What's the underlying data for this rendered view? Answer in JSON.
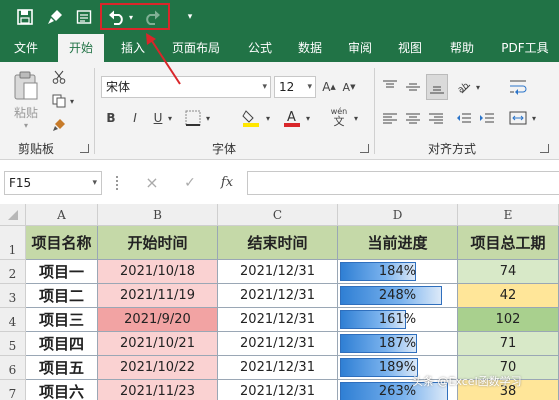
{
  "qat": {
    "save": "save-icon",
    "format_painter": "paintbrush-icon",
    "form": "form-icon",
    "undo": "undo-icon",
    "redo": "redo-icon",
    "customize": "customize-qat-icon"
  },
  "tabs": [
    "文件",
    "开始",
    "插入",
    "页面布局",
    "公式",
    "数据",
    "审阅",
    "视图",
    "帮助",
    "PDF工具"
  ],
  "active_tab": "开始",
  "ribbon": {
    "clipboard": {
      "paste_label": "粘贴",
      "group_label": "剪贴板"
    },
    "font": {
      "font_name": "宋体",
      "font_size": "12",
      "bold": "B",
      "italic": "I",
      "underline": "U",
      "wen": "wén",
      "group_label": "字体"
    },
    "alignment": {
      "group_label": "对齐方式"
    }
  },
  "formula_bar": {
    "name_box": "F15",
    "cancel": "×",
    "enter": "✓",
    "fx": "fx",
    "formula": ""
  },
  "colors": {
    "accent": "#217346",
    "header_fill": "#c5d9a8",
    "pink_light": "#fad2d2",
    "pink_dark": "#f2a3a3",
    "green_fill": "#a9d08e",
    "green_light": "#d8e9c8",
    "yellow_fill": "#ffe699",
    "bar_blue": "#2f7fd4"
  },
  "grid": {
    "columns": [
      "A",
      "B",
      "C",
      "D",
      "E"
    ],
    "rows": [
      "1",
      "2",
      "3",
      "4",
      "5",
      "6",
      "7"
    ],
    "headers": [
      "项目名称",
      "开始时间",
      "结束时间",
      "当前进度",
      "项目总工期"
    ],
    "data": [
      {
        "name": "项目一",
        "start": "2021/10/18",
        "end": "2021/12/31",
        "progress": "184%",
        "progress_value": 184,
        "duration": "74"
      },
      {
        "name": "项目二",
        "start": "2021/11/19",
        "end": "2021/12/31",
        "progress": "248%",
        "progress_value": 248,
        "duration": "42"
      },
      {
        "name": "项目三",
        "start": "2021/9/20",
        "end": "2021/12/31",
        "progress": "161%",
        "progress_value": 161,
        "duration": "102"
      },
      {
        "name": "项目四",
        "start": "2021/10/21",
        "end": "2021/12/31",
        "progress": "187%",
        "progress_value": 187,
        "duration": "71"
      },
      {
        "name": "项目五",
        "start": "2021/10/22",
        "end": "2021/12/31",
        "progress": "189%",
        "progress_value": 189,
        "duration": "70"
      },
      {
        "name": "项目六",
        "start": "2021/11/23",
        "end": "2021/12/31",
        "progress": "263%",
        "progress_value": 263,
        "duration": "38"
      }
    ]
  },
  "watermark": "头条 @Excel函数学习"
}
